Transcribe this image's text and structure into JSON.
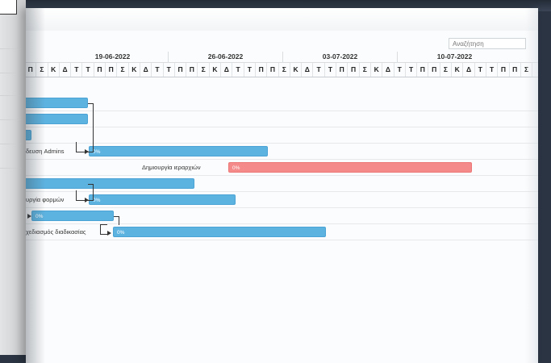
{
  "search": {
    "placeholder": "Αναζήτηση"
  },
  "timeline": {
    "weeks": [
      "19-06-2022",
      "26-06-2022",
      "03-07-2022",
      "10-07-2022"
    ],
    "days": [
      "Π",
      "Σ",
      "Κ",
      "Δ",
      "Τ",
      "Τ",
      "Π",
      "Π",
      "Σ",
      "Κ",
      "Δ",
      "Τ",
      "Τ",
      "Π",
      "Π",
      "Σ",
      "Κ",
      "Δ",
      "Τ",
      "Τ",
      "Π",
      "Π",
      "Σ",
      "Κ",
      "Δ",
      "Τ",
      "Τ",
      "Π",
      "Π",
      "Σ",
      "Κ",
      "Δ",
      "Τ",
      "Τ",
      "Π",
      "Π",
      "Σ",
      "Κ",
      "Δ",
      "Τ",
      "Τ",
      "Π",
      "Π",
      "Σ"
    ]
  },
  "tasks": [
    {
      "label": "",
      "progress": "",
      "color": "blue"
    },
    {
      "label": "",
      "progress": "",
      "color": "blue"
    },
    {
      "label": "",
      "progress": "",
      "color": "blue"
    },
    {
      "label": "δευση Admins",
      "progress": "0%",
      "color": "blue"
    },
    {
      "label": "Δημιουργία ιεραρχιών",
      "progress": "0%",
      "color": "red"
    },
    {
      "label": "",
      "progress": "",
      "color": "blue"
    },
    {
      "label": "υργία φορμών",
      "progress": "0%",
      "color": "blue"
    },
    {
      "label": "",
      "progress": "0%",
      "color": "blue"
    },
    {
      "label": "χεδιασμός διαδικασίας",
      "progress": "0%",
      "color": "blue"
    }
  ],
  "colors": {
    "bar_blue": "#5db3e0",
    "bar_red": "#f48a8a"
  }
}
